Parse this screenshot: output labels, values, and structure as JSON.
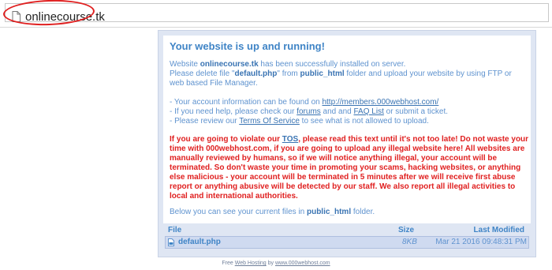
{
  "address_bar": {
    "url": "onlinecourse.tk"
  },
  "panel": {
    "title": "Your website is up and running!",
    "intro": {
      "l1_a": "Website ",
      "l1_domain": "onlinecourse.tk",
      "l1_b": " has been successfully installed on server.",
      "l2_a": "Please delete file \"",
      "l2_file": "default.php",
      "l2_b": "\" from ",
      "l2_folder": "public_html",
      "l2_c": " folder and upload your website by using FTP or",
      "l3": "web based File Manager."
    },
    "links": {
      "l1_a": "- Your account information can be found on ",
      "l1_link": "http://members.000webhost.com/",
      "l2_a": "- If you need help, please check our ",
      "l2_forums": "forums",
      "l2_b": " and and ",
      "l2_faq": "FAQ List",
      "l2_c": " or submit a ticket.",
      "l3_a": "- Please review our ",
      "l3_tos": "Terms Of Service",
      "l3_b": " to see what is not allowed to upload."
    },
    "warning": {
      "a": "If you are going to violate our ",
      "tos": "TOS",
      "b": ", please read this text until it's not too late! Do not waste your time with 000webhost.com, if you are going to upload any illegal website here! All websites are manually reviewed by humans, so if we will notice anything illegal, your account will be terminated. So don't waste your time in promoting your scams, hacking websites, or anything else malicious - your account will be terminated in 5 minutes after we will receive first abuse report or anything abusive will be detected by our staff. We also report all illegal activities to local and international authorities."
    },
    "files_note": {
      "a": "Below you can see your current files in ",
      "folder": "public_html",
      "b": " folder."
    },
    "files_table": {
      "header_file": "File",
      "header_size": "Size",
      "header_modified": "Last Modified",
      "rows": [
        {
          "name": "default.php",
          "size": "8KB",
          "modified": "Mar 21 2016 09:48:31 PM"
        }
      ]
    }
  },
  "footer": {
    "a": "Free ",
    "link1": "Web Hosting",
    "b": " by ",
    "link2": "www.000webhost.com"
  }
}
